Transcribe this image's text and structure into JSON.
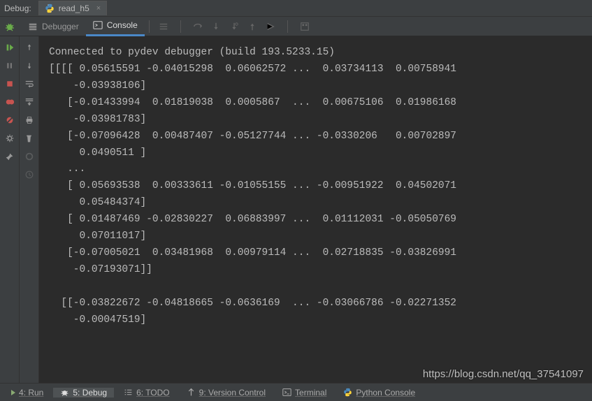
{
  "top": {
    "debug_label": "Debug:",
    "script_name": "read_h5"
  },
  "subtabs": {
    "debugger": "Debugger",
    "console": "Console"
  },
  "console_text": "Connected to pydev debugger (build 193.5233.15)\n[[[[ 0.05615591 -0.04015298  0.06062572 ...  0.03734113  0.00758941\n    -0.03938106]\n   [-0.01433994  0.01819038  0.0005867  ...  0.00675106  0.01986168\n    -0.03981783]\n   [-0.07096428  0.00487407 -0.05127744 ... -0.0330206   0.00702897\n     0.0490511 ]\n   ...\n   [ 0.05693538  0.00333611 -0.01055155 ... -0.00951922  0.04502071\n     0.05484374]\n   [ 0.01487469 -0.02830227  0.06883997 ...  0.01112031 -0.05050769\n     0.07011017]\n   [-0.07005021  0.03481968  0.00979114 ...  0.02718835 -0.03826991\n    -0.07193071]]\n\n  [[-0.03822672 -0.04818665 -0.0636169  ... -0.03066786 -0.02271352\n    -0.00047519]",
  "bottom": {
    "run": "4: Run",
    "debug": "5: Debug",
    "todo": "6: TODO",
    "vcs": "9: Version Control",
    "terminal": "Terminal",
    "pyconsole": "Python Console"
  },
  "watermark": "https://blog.csdn.net/qq_37541097"
}
